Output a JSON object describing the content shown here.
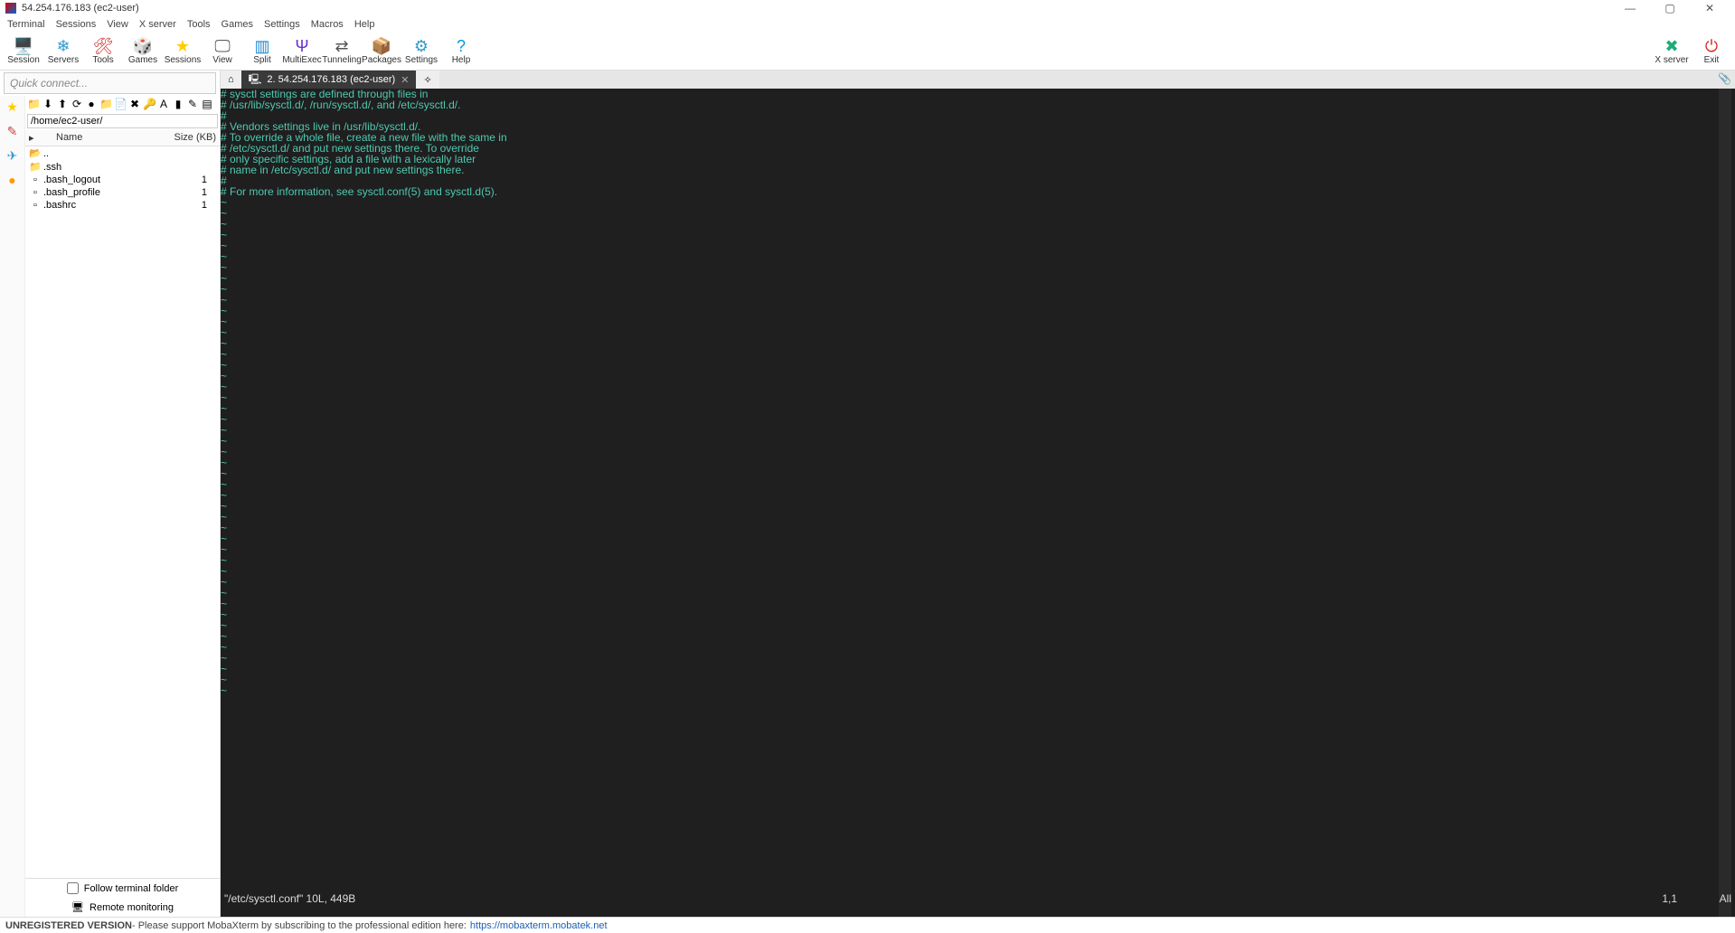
{
  "title": "54.254.176.183 (ec2-user)",
  "menu": [
    "Terminal",
    "Sessions",
    "View",
    "X server",
    "Tools",
    "Games",
    "Settings",
    "Macros",
    "Help"
  ],
  "tools": [
    {
      "label": "Session",
      "icon": "🖥️",
      "color": "#1a6"
    },
    {
      "label": "Servers",
      "icon": "❄",
      "color": "#39c"
    },
    {
      "label": "Tools",
      "icon": "🛠",
      "color": "#c33"
    },
    {
      "label": "Games",
      "icon": "🎲",
      "color": "#8a6"
    },
    {
      "label": "Sessions",
      "icon": "★",
      "color": "#fc0"
    },
    {
      "label": "View",
      "icon": "🖵",
      "color": "#555"
    },
    {
      "label": "Split",
      "icon": "▥",
      "color": "#28c"
    },
    {
      "label": "MultiExec",
      "icon": "Ψ",
      "color": "#63c"
    },
    {
      "label": "Tunneling",
      "icon": "⇄",
      "color": "#555"
    },
    {
      "label": "Packages",
      "icon": "📦",
      "color": "#a63"
    },
    {
      "label": "Settings",
      "icon": "⚙",
      "color": "#39c"
    },
    {
      "label": "Help",
      "icon": "?",
      "color": "#09d"
    }
  ],
  "tools_right": [
    {
      "label": "X server",
      "icon": "✖",
      "color": "#2a7"
    },
    {
      "label": "Exit",
      "icon": "⏻",
      "color": "#d22"
    }
  ],
  "sidebar": {
    "quick_connect_placeholder": "Quick connect...",
    "vtabs_icons": [
      "★",
      "✎",
      "✈",
      "●"
    ],
    "mini_icons": [
      "📁",
      "⬇",
      "⬆",
      "⟳",
      "●",
      "📁",
      "📄",
      "✖",
      "🔑",
      "A",
      "▮",
      "✎",
      "▤"
    ],
    "path": "/home/ec2-user/",
    "columns": {
      "name": "Name",
      "size": "Size (KB)"
    },
    "files": [
      {
        "icon": "📂",
        "name": "..",
        "size": ""
      },
      {
        "icon": "📁",
        "name": ".ssh",
        "size": ""
      },
      {
        "icon": "▫",
        "name": ".bash_logout",
        "size": "1"
      },
      {
        "icon": "▫",
        "name": ".bash_profile",
        "size": "1"
      },
      {
        "icon": "▫",
        "name": ".bashrc",
        "size": "1"
      }
    ],
    "follow_label": "Follow terminal folder",
    "remote_label": "Remote monitoring"
  },
  "tabs": {
    "home_icon": "⌂",
    "active": {
      "icon": "🖳",
      "label": "2. 54.254.176.183 (ec2-user)"
    },
    "new_icon": "✧"
  },
  "terminal": {
    "lines": [
      "# sysctl settings are defined through files in",
      "# /usr/lib/sysctl.d/, /run/sysctl.d/, and /etc/sysctl.d/.",
      "#",
      "# Vendors settings live in /usr/lib/sysctl.d/.",
      "# To override a whole file, create a new file with the same in",
      "# /etc/sysctl.d/ and put new settings there. To override",
      "# only specific settings, add a file with a lexically later",
      "# name in /etc/sysctl.d/ and put new settings there.",
      "#",
      "# For more information, see sysctl.conf(5) and sysctl.d(5)."
    ],
    "tilde": "~",
    "tilde_count": 46,
    "status_left": "\"/etc/sysctl.conf\" 10L, 449B",
    "status_mid": "1,1",
    "status_right": "All"
  },
  "footer": {
    "bold": "UNREGISTERED VERSION",
    "text": " - Please support MobaXterm by subscribing to the professional edition here: ",
    "link": "https://mobaxterm.mobatek.net"
  }
}
